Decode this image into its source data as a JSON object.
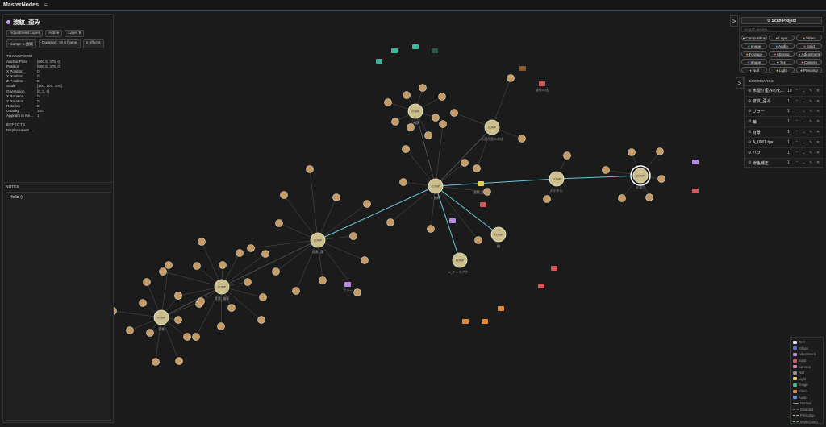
{
  "app": {
    "title": "MasterNodes"
  },
  "layer": {
    "name": "波紋_歪み",
    "chips": [
      "Adjustment Layer",
      "Active",
      "Layer 8",
      "Comp: 1.曲戦",
      "Duration: 3s 0 frame",
      "1 effects"
    ],
    "transform_title": "TRANSFORM",
    "transform": [
      {
        "k": "Anchor Point",
        "v": "[600.5, 475, 0]"
      },
      {
        "k": "Position",
        "v": "[600.5, 475, 0]"
      },
      {
        "k": "X Position",
        "v": "0"
      },
      {
        "k": "Y Position",
        "v": "0"
      },
      {
        "k": "Z Position",
        "v": "0"
      },
      {
        "k": "Scale",
        "v": "[100, 100, 100]"
      },
      {
        "k": "Orientation",
        "v": "[0, 0, 0]"
      },
      {
        "k": "X Rotation",
        "v": "0"
      },
      {
        "k": "Y Rotation",
        "v": "0"
      },
      {
        "k": "Rotation",
        "v": "0"
      },
      {
        "k": "Opacity",
        "v": "100"
      },
      {
        "k": "Appears in Re...",
        "v": "1"
      }
    ],
    "effects_title": "EFFECTS",
    "effects": [
      "Displacement ..."
    ],
    "notes_title": "NOTES",
    "notes_text": "Hello :)"
  },
  "toggle_label": ">",
  "project": {
    "scan_label": "↺ Scan Project",
    "search_placeholder": "Search assets...",
    "filters": [
      {
        "label": "Composition",
        "color": "#d8c27a"
      },
      {
        "label": "Layer",
        "color": "#7aa6d8"
      },
      {
        "label": "Video",
        "color": "#e08a3a"
      },
      {
        "label": "Image",
        "color": "#3fb59a"
      },
      {
        "label": "Audio",
        "color": "#5b8de0"
      },
      {
        "label": "Solid",
        "color": "#e05a5a"
      },
      {
        "label": "Footage",
        "color": "#e0a040"
      },
      {
        "label": "Missing",
        "color": "#e05a5a"
      },
      {
        "label": "Adjustment",
        "color": "#b58ae0"
      },
      {
        "label": "Shape",
        "color": "#7a7ad8"
      },
      {
        "label": "Text",
        "color": "#e0e0e0"
      },
      {
        "label": "Camera",
        "color": "#e07aa6"
      },
      {
        "label": "Null",
        "color": "#9a9a9a"
      },
      {
        "label": "Light",
        "color": "#e0d05a"
      },
      {
        "label": "Precomp",
        "color": "#d8b07a"
      }
    ]
  },
  "bookmarks": {
    "title": "BOOKMARKS",
    "items": [
      {
        "name": "水溜り歪みの化...",
        "count": "10"
      },
      {
        "name": "波紋_歪み",
        "count": "1"
      },
      {
        "name": "ブラー",
        "count": "1"
      },
      {
        "name": "輪",
        "count": "1"
      },
      {
        "name": "背景",
        "count": "1"
      },
      {
        "name": "A_0001.tga",
        "count": "1"
      },
      {
        "name": "バラ",
        "count": "1"
      },
      {
        "name": "線色補正",
        "count": "1"
      }
    ],
    "actions": [
      "⌃",
      "⌄",
      "✎",
      "✕"
    ]
  },
  "legend": [
    {
      "label": "Text",
      "kind": "swatch",
      "color": "#e0e0e0"
    },
    {
      "label": "Shape",
      "kind": "swatch",
      "color": "#5b6cd8"
    },
    {
      "label": "Adjustment",
      "kind": "swatch",
      "color": "#b58ae0"
    },
    {
      "label": "Solid",
      "kind": "swatch",
      "color": "#d05a5a"
    },
    {
      "label": "Camera",
      "kind": "swatch",
      "color": "#e07aa6"
    },
    {
      "label": "Null",
      "kind": "swatch",
      "color": "#8a8a8a"
    },
    {
      "label": "Light",
      "kind": "swatch",
      "color": "#e0d05a"
    },
    {
      "label": "Image",
      "kind": "swatch",
      "color": "#3fb59a"
    },
    {
      "label": "Video",
      "kind": "swatch",
      "color": "#e08a3a"
    },
    {
      "label": "Audio",
      "kind": "swatch",
      "color": "#5b8de0"
    },
    {
      "label": "Normal",
      "kind": "line",
      "color": "#9a9a9a"
    },
    {
      "label": "Disabled",
      "kind": "line",
      "color": "#666666"
    },
    {
      "label": "PreComp",
      "kind": "line",
      "color": "#d8c27a"
    },
    {
      "label": "MatteComp",
      "kind": "line",
      "color": "#7ab8d8"
    }
  ],
  "graph": {
    "comp_label": "COMP",
    "node_labels": {
      "master": "1.曲戦",
      "comp_top": "水面",
      "comp_top_right": "水溜り歪みの化",
      "comp_right": "2.ホタル",
      "comp_selected": "水溜り",
      "comp_left": "背景_葉",
      "comp_left2": "背景_輪郭",
      "comp_left3": "背景",
      "comp_mid": "輪",
      "comp_mid2": "4_キャラクター",
      "adj_selected": "波紋_歪み",
      "adj_blur": "ブラー",
      "solid_top": "波紋の化"
    }
  }
}
